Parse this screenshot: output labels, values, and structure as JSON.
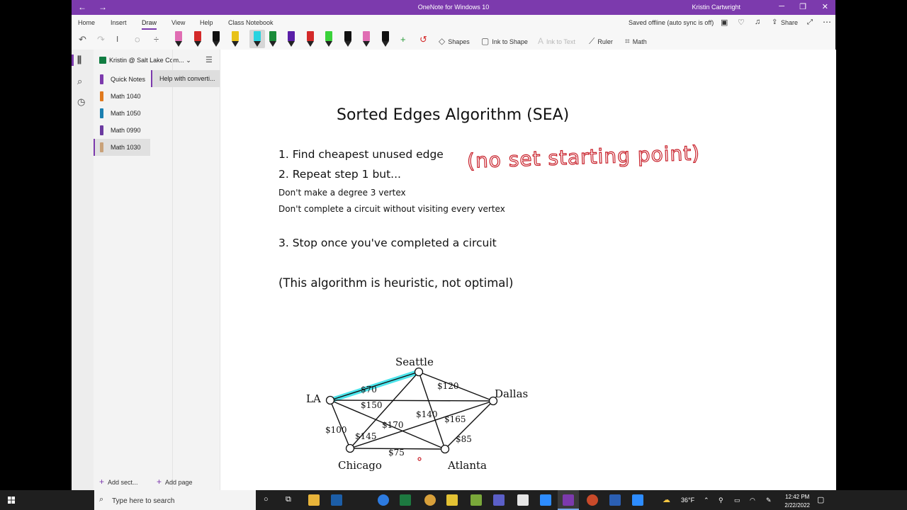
{
  "window": {
    "back_icon": "←",
    "forward_icon": "→",
    "title": "OneNote for Windows 10",
    "user": "Kristin Cartwright",
    "minimize": "─",
    "restore": "❐",
    "close": "✕"
  },
  "menu": {
    "tabs": [
      "Home",
      "Insert",
      "Draw",
      "View",
      "Help",
      "Class Notebook"
    ],
    "active_tab": "Draw",
    "status": "Saved offline (auto sync is off)",
    "share": "Share"
  },
  "ribbon": {
    "shapes": "Shapes",
    "ink_to_shape": "Ink to Shape",
    "ink_to_text": "Ink to Text",
    "ruler": "Ruler",
    "math": "Math",
    "pen_colors": [
      "#e06db3",
      "#d42a2a",
      "#111111",
      "#e8c21a",
      "#29d3e0",
      "#1a8c3a",
      "#5a1fa8",
      "#d42a2a",
      "#3ad23a",
      "#111111",
      "#e06db3",
      "#111111"
    ]
  },
  "notebook": {
    "name": "Kristin @ Salt Lake Com...",
    "sections": [
      {
        "label": "Quick Notes",
        "color": "#7c3aad"
      },
      {
        "label": "Math 1040",
        "color": "#e07a1f"
      },
      {
        "label": "Math 1050",
        "color": "#1b7fb0"
      },
      {
        "label": "Math 0990",
        "color": "#6b3aa0"
      },
      {
        "label": "Math 1030",
        "color": "#c9a27a"
      }
    ],
    "selected_section": "Math 1030",
    "pages": [
      "Help with converti..."
    ],
    "add_section": "Add sect...",
    "add_page": "Add page"
  },
  "note": {
    "title": "Sorted Edges Algorithm (SEA)",
    "step1": "1.  Find cheapest unused edge",
    "step2": "2.  Repeat step 1 but...",
    "rule1": "Don't make a degree 3 vertex",
    "rule2": "Don't complete a circuit without visiting every vertex",
    "step3": "3. Stop once you've completed a circuit",
    "note": "(This algorithm is heuristic, not optimal)",
    "handwriting": "(no set starting point)",
    "graph": {
      "vertices": [
        "Seattle",
        "LA",
        "Dallas",
        "Chicago",
        "Atlanta"
      ],
      "edge_labels": [
        "$70",
        "$120",
        "$150",
        "$140",
        "$165",
        "$100",
        "$145",
        "$170",
        "$85",
        "$75"
      ]
    }
  },
  "taskbar": {
    "search_placeholder": "Type here to search",
    "weather": "36°F",
    "time": "12:42 PM",
    "date": "2/22/2022"
  }
}
